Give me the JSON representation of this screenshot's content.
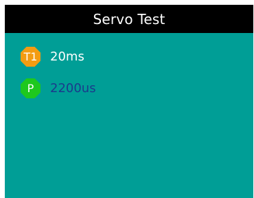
{
  "title": "Servo Test",
  "items": [
    {
      "badge_label": "T1",
      "badge_color": "#f39c12",
      "value": "20ms",
      "value_color": "#ffffff"
    },
    {
      "badge_label": "P",
      "badge_color": "#1ec81e",
      "value": "2200us",
      "value_color": "#1b3a8c"
    }
  ],
  "colors": {
    "screen_bg": "#009e96",
    "title_bar_bg": "#000000",
    "title_text": "#ffffff"
  }
}
